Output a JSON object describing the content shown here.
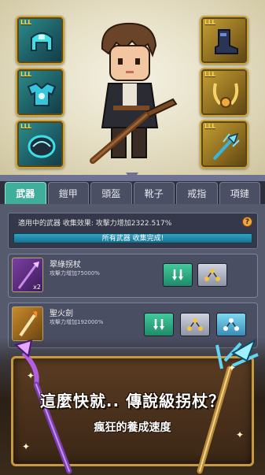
{
  "equipment_slots": {
    "left": [
      {
        "level_label": "LLL",
        "icon": "teal-helmet-icon"
      },
      {
        "level_label": "LLL",
        "icon": "teal-armor-icon"
      },
      {
        "level_label": "LLL",
        "icon": "teal-boots-icon"
      }
    ],
    "right": [
      {
        "level_label": "LLL",
        "icon": "gold-boot-icon"
      },
      {
        "level_label": "LLL",
        "icon": "gold-necklace-icon"
      },
      {
        "level_label": "LLL",
        "icon": "gold-trident-icon"
      }
    ]
  },
  "tabs": [
    {
      "label": "武器",
      "active": true
    },
    {
      "label": "鎧甲",
      "active": false
    },
    {
      "label": "頭盔",
      "active": false
    },
    {
      "label": "靴子",
      "active": false
    },
    {
      "label": "戒指",
      "active": false
    },
    {
      "label": "項鏈",
      "active": false
    }
  ],
  "collection": {
    "info": "適用中的武器 收集效果: 攻擊力增加2322.517%",
    "help_icon": "?",
    "complete_label": "所有武器 收集完成!"
  },
  "items": [
    {
      "name": "翠綠拐杖",
      "effect": "攻擊力增加75000%",
      "count": "x2"
    },
    {
      "name": "聖火劍",
      "effect": "攻擊力增加192000%"
    }
  ],
  "banner": {
    "headline": "這麼快就.. 傳說級拐杖？",
    "subline": "瘋狂的養成速度"
  },
  "colors": {
    "active_tab": "#3fae9a",
    "complete_bar": "#2aa5c7",
    "gold_frame": "#c79a3e"
  }
}
